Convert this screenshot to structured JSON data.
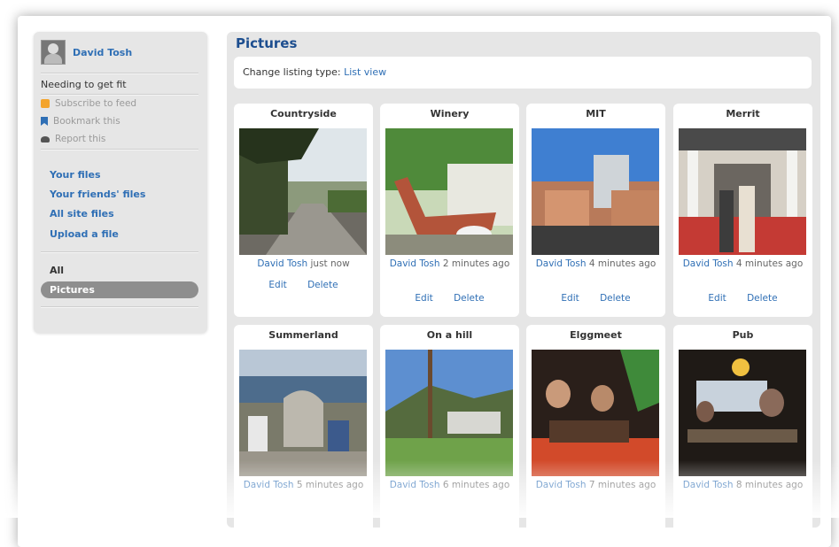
{
  "sidebar": {
    "owner_name": "David Tosh",
    "entity_title": "Needing to get fit",
    "actions": [
      "Subscribe to feed",
      "Bookmark this",
      "Report this"
    ],
    "nav": [
      "Your files",
      "Your friends' files",
      "All site files",
      "Upload a file"
    ],
    "filters": [
      "All",
      "Pictures"
    ],
    "selected_filter": "Pictures"
  },
  "main": {
    "heading": "Pictures",
    "listing_label": "Change listing type:",
    "listing_link": "List view",
    "edit_label": "Edit",
    "delete_label": "Delete",
    "items": [
      {
        "title": "Countryside",
        "user": "David Tosh",
        "time": "just now"
      },
      {
        "title": "Winery",
        "user": "David Tosh",
        "time": "2 minutes ago"
      },
      {
        "title": "MIT",
        "user": "David Tosh",
        "time": "4 minutes ago"
      },
      {
        "title": "Merrit",
        "user": "David Tosh",
        "time": "4 minutes ago"
      },
      {
        "title": "Summerland",
        "user": "David Tosh",
        "time": "5 minutes ago"
      },
      {
        "title": "On a hill",
        "user": "David Tosh",
        "time": "6 minutes ago"
      },
      {
        "title": "Elggmeet",
        "user": "David Tosh",
        "time": "7 minutes ago"
      },
      {
        "title": "Pub",
        "user": "David Tosh",
        "time": "8 minutes ago"
      }
    ]
  },
  "colors": {
    "link": "#2f6fb5",
    "heading": "#1d4e8f",
    "panel": "#e6e6e6"
  }
}
